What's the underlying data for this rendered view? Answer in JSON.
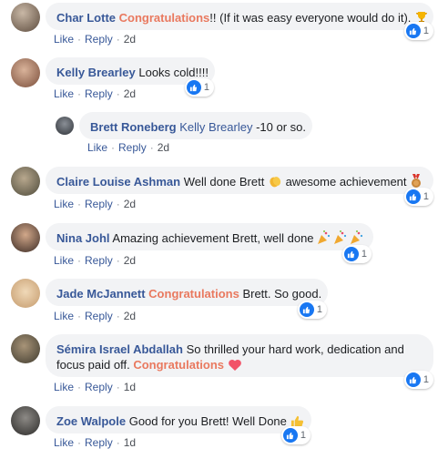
{
  "comments": [
    {
      "author": "Char Lotte",
      "congrats": "Congratulations",
      "text": "!! (If it was easy everyone would do it).",
      "like": "Like",
      "reply": "Reply",
      "time": "2d",
      "reactions": "1"
    },
    {
      "author": "Kelly Brearley",
      "text": "Looks cold!!!!",
      "like": "Like",
      "reply": "Reply",
      "time": "2d",
      "reactions": "1"
    },
    {
      "author": "Brett Roneberg",
      "mention": "Kelly Brearley",
      "text": " -10 or so.",
      "like": "Like",
      "reply": "Reply",
      "time": "2d"
    },
    {
      "author": "Claire Louise Ashman",
      "text": "Well done Brett ",
      "text2": " awesome achievement ",
      "like": "Like",
      "reply": "Reply",
      "time": "2d",
      "reactions": "1"
    },
    {
      "author": "Nina Johl",
      "text": "Amazing achievement Brett, well done ",
      "like": "Like",
      "reply": "Reply",
      "time": "2d",
      "reactions": "1"
    },
    {
      "author": "Jade McJannett",
      "congrats": "Congratulations",
      "text": " Brett. So good.",
      "like": "Like",
      "reply": "Reply",
      "time": "2d",
      "reactions": "1"
    },
    {
      "author": "Sémira Israel Abdallah",
      "text": "So thrilled your hard work, dedication and",
      "text_line2": "focus paid off. ",
      "congrats": "Congratulations",
      "like": "Like",
      "reply": "Reply",
      "time": "1d",
      "reactions": "1"
    },
    {
      "author": "Zoe Walpole",
      "text": "Good for you Brett! Well Done ",
      "like": "Like",
      "reply": "Reply",
      "time": "1d",
      "reactions": "1"
    }
  ],
  "colors": {
    "link": "#385898",
    "congrats": "#e9795f",
    "bubble": "#f2f3f5",
    "like_badge": "#1877f2"
  },
  "icons": [
    "trophy-icon",
    "clapping-hands-icon",
    "medal-icon",
    "party-popper-icon",
    "heart-icon",
    "thumbs-up-icon",
    "like-badge-icon"
  ]
}
